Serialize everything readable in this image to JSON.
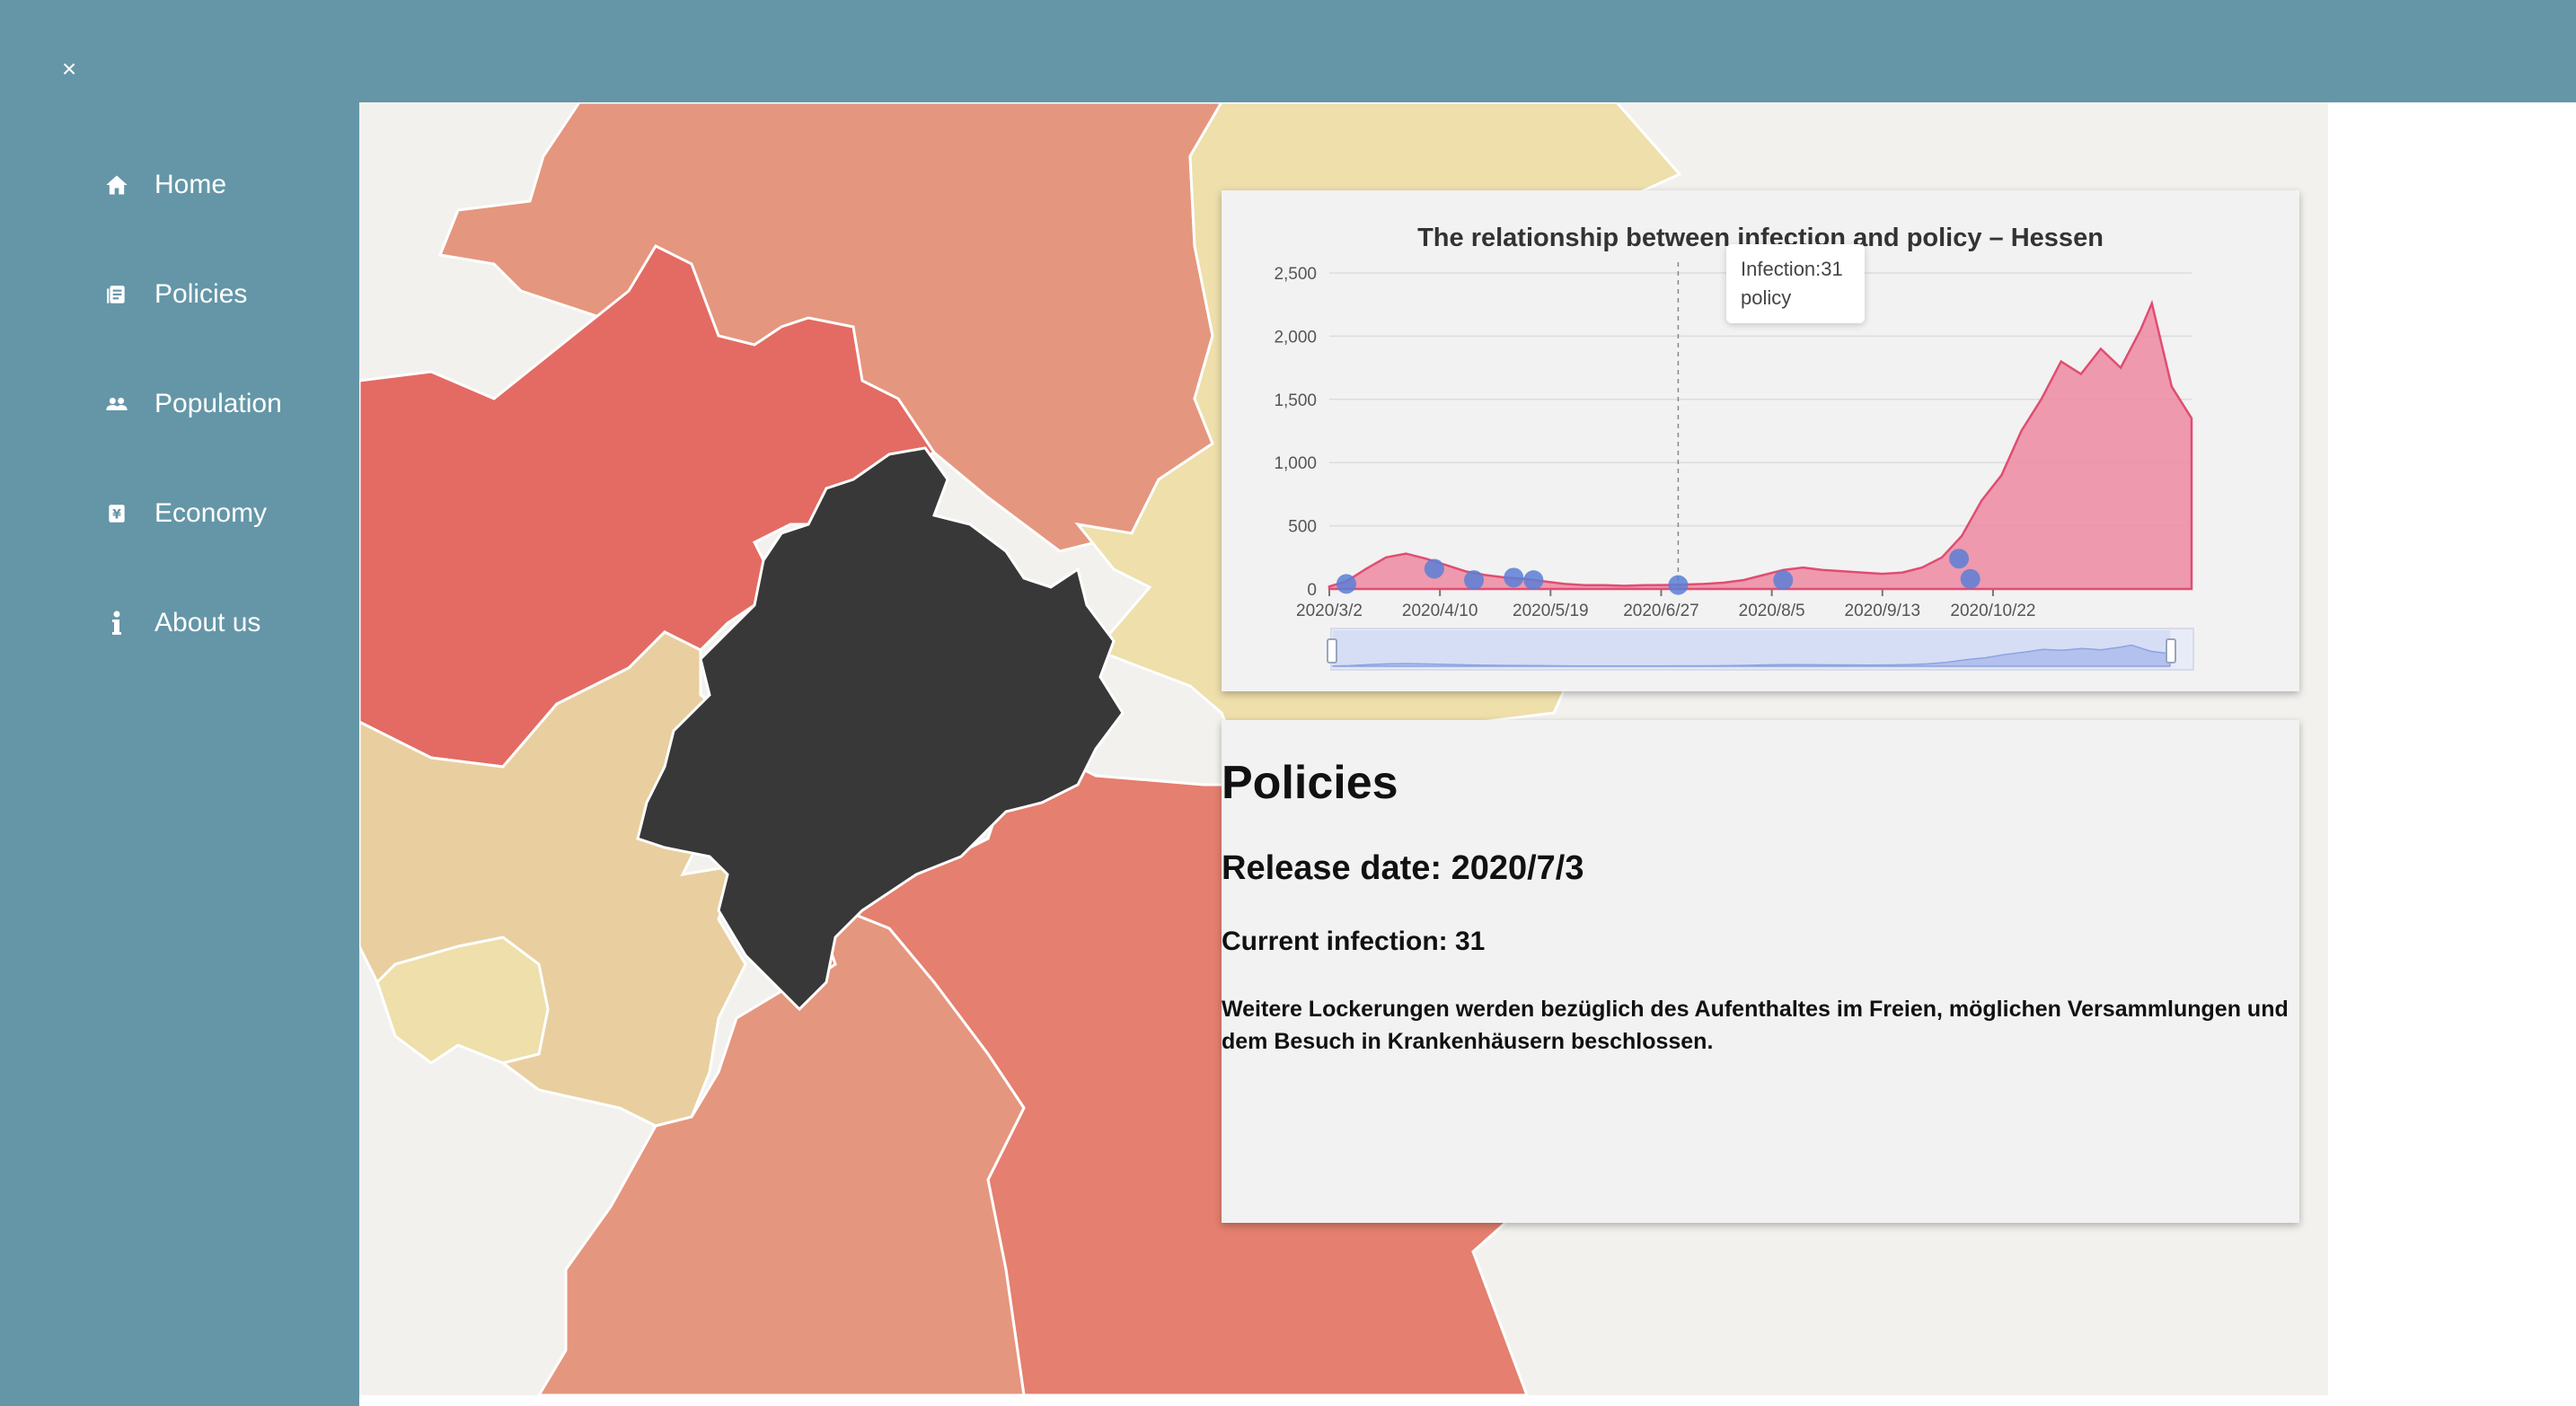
{
  "app": {
    "close_label": "×"
  },
  "nav": {
    "items": [
      {
        "label": "Home",
        "icon": "home-icon"
      },
      {
        "label": "Policies",
        "icon": "document-icon"
      },
      {
        "label": "Population",
        "icon": "people-icon"
      },
      {
        "label": "Economy",
        "icon": "economy-icon"
      },
      {
        "label": "About us",
        "icon": "info-icon"
      }
    ]
  },
  "map": {
    "highlighted_region": "Hessen",
    "colors": {
      "highlight": "#383838",
      "high": "#e36b63",
      "mid_high": "#e57f6f",
      "mid": "#e5967e",
      "low_mid": "#e9cf9f",
      "low": "#eedfab",
      "background": "#f2f1ee"
    }
  },
  "chart_data": {
    "type": "area",
    "title": "The relationship between infection and policy – Hessen",
    "x_tick_labels": [
      "2020/3/2",
      "2020/4/10",
      "2020/5/19",
      "2020/6/27",
      "2020/8/5",
      "2020/9/13",
      "2020/10/22"
    ],
    "y_tick_labels": [
      "0",
      "500",
      "1,000",
      "1,500",
      "2,000",
      "2,500"
    ],
    "ylim": [
      0,
      2500
    ],
    "xlim": [
      "2020/3/2",
      "2020/12/31"
    ],
    "grid": true,
    "series": [
      {
        "name": "Infection",
        "color": "#e8537a",
        "points": [
          [
            "2020/3/2",
            20
          ],
          [
            "2020/3/8",
            60
          ],
          [
            "2020/3/15",
            160
          ],
          [
            "2020/3/22",
            250
          ],
          [
            "2020/3/29",
            280
          ],
          [
            "2020/4/5",
            240
          ],
          [
            "2020/4/12",
            190
          ],
          [
            "2020/4/19",
            140
          ],
          [
            "2020/4/26",
            110
          ],
          [
            "2020/5/3",
            90
          ],
          [
            "2020/5/10",
            80
          ],
          [
            "2020/5/17",
            60
          ],
          [
            "2020/5/24",
            40
          ],
          [
            "2020/5/31",
            30
          ],
          [
            "2020/6/7",
            30
          ],
          [
            "2020/6/14",
            25
          ],
          [
            "2020/6/21",
            30
          ],
          [
            "2020/6/28",
            31
          ],
          [
            "2020/7/5",
            35
          ],
          [
            "2020/7/12",
            40
          ],
          [
            "2020/7/19",
            50
          ],
          [
            "2020/7/26",
            70
          ],
          [
            "2020/8/2",
            110
          ],
          [
            "2020/8/9",
            150
          ],
          [
            "2020/8/16",
            170
          ],
          [
            "2020/8/23",
            150
          ],
          [
            "2020/8/30",
            140
          ],
          [
            "2020/9/6",
            130
          ],
          [
            "2020/9/13",
            120
          ],
          [
            "2020/9/20",
            130
          ],
          [
            "2020/9/27",
            170
          ],
          [
            "2020/10/4",
            250
          ],
          [
            "2020/10/11",
            420
          ],
          [
            "2020/10/18",
            700
          ],
          [
            "2020/10/25",
            900
          ],
          [
            "2020/11/1",
            1250
          ],
          [
            "2020/11/8",
            1500
          ],
          [
            "2020/11/15",
            1800
          ],
          [
            "2020/11/22",
            1700
          ],
          [
            "2020/11/29",
            1900
          ],
          [
            "2020/12/6",
            1750
          ],
          [
            "2020/12/13",
            2050
          ],
          [
            "2020/12/17",
            2260
          ],
          [
            "2020/12/24",
            1600
          ],
          [
            "2020/12/31",
            1350
          ]
        ]
      },
      {
        "name": "policy",
        "color": "#5b7fd6",
        "points": [
          [
            "2020/3/8",
            40
          ],
          [
            "2020/4/8",
            160
          ],
          [
            "2020/4/22",
            70
          ],
          [
            "2020/5/6",
            90
          ],
          [
            "2020/5/13",
            70
          ],
          [
            "2020/7/3",
            31
          ],
          [
            "2020/8/9",
            70
          ],
          [
            "2020/10/10",
            240
          ],
          [
            "2020/10/14",
            80
          ]
        ]
      }
    ],
    "tooltip": {
      "infection_label": "Infection:31",
      "series_label": "policy"
    }
  },
  "policy": {
    "title": "Policies",
    "release_date": "Release date: 2020/7/3",
    "current_infection": "Current infection: 31",
    "description": "Weitere Lockerungen werden bezüglich des Aufenthaltes im Freien, möglichen Versammlungen und dem Besuch in Krankenhäusern beschlossen."
  }
}
